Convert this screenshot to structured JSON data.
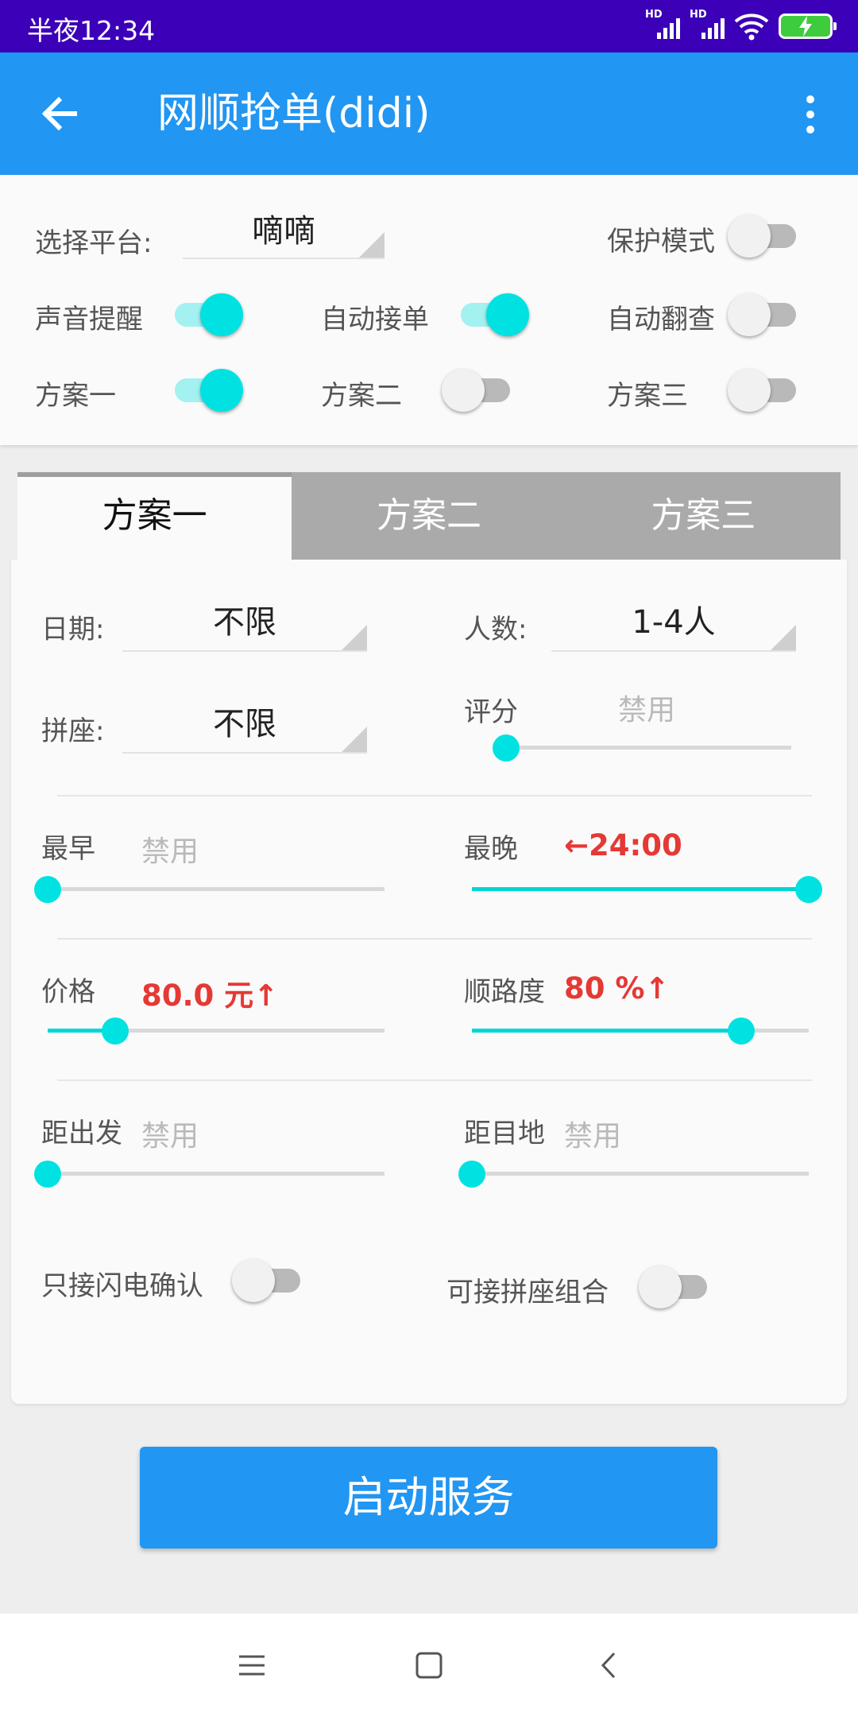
{
  "status_bar": {
    "time": "半夜12:34",
    "sim1": "HD",
    "sim2": "HD"
  },
  "app_bar": {
    "title": "网顺抢单(didi)",
    "back_icon": "arrow-back-icon",
    "menu_icon": "more-vert-icon"
  },
  "top": {
    "platform_label": "选择平台:",
    "platform_value": "嘀嘀",
    "protect_mode": {
      "label": "保护模式",
      "on": false
    },
    "sound_alert": {
      "label": "声音提醒",
      "on": true
    },
    "auto_accept": {
      "label": "自动接单",
      "on": true
    },
    "auto_check": {
      "label": "自动翻查",
      "on": false
    },
    "plan1": {
      "label": "方案一",
      "on": true
    },
    "plan2": {
      "label": "方案二",
      "on": false
    },
    "plan3": {
      "label": "方案三",
      "on": false
    }
  },
  "tabs": [
    "方案一",
    "方案二",
    "方案三"
  ],
  "active_tab": 0,
  "plan": {
    "date_label": "日期:",
    "date_value": "不限",
    "people_label": "人数:",
    "people_value": "1-4人",
    "carpool_label": "拼座:",
    "carpool_value": "不限",
    "rating_label": "评分",
    "rating_value": "禁用",
    "rating_level": 0.03,
    "earliest_label": "最早",
    "earliest_value": "禁用",
    "earliest_level": 0,
    "latest_label": "最晚",
    "latest_value": "←24:00",
    "latest_level": 1.0,
    "price_label": "价格",
    "price_value": "80.0 元↑",
    "price_level": 0.2,
    "route_label": "顺路度",
    "route_value": "80 %↑",
    "route_level": 0.8,
    "dist_start_label": "距出发",
    "dist_start_value": "禁用",
    "dist_start_level": 0,
    "dist_dest_label": "距目地",
    "dist_dest_value": "禁用",
    "dist_dest_level": 0,
    "flash_confirm": {
      "label": "只接闪电确认",
      "on": false
    },
    "carpool_combo": {
      "label": "可接拼座组合",
      "on": false
    }
  },
  "start_button": "启动服务",
  "colors": {
    "primary": "#2196f3",
    "status_bar": "#3b00b8",
    "accent": "#00e2e2",
    "warning": "#e53935"
  }
}
